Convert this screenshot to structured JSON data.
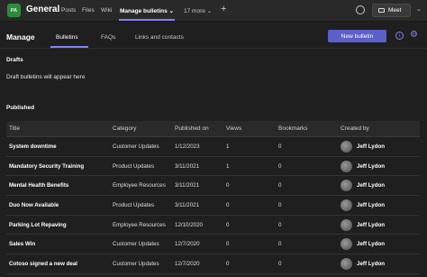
{
  "header": {
    "team_initials": "PA",
    "channel_name": "General",
    "tabs": [
      "Posts",
      "Files",
      "Wiki",
      "Manage bulletins",
      "17 more"
    ],
    "active_tab": "Manage bulletins",
    "meet_label": "Meet"
  },
  "manage": {
    "title": "Manage",
    "tabs": [
      "Bulletins",
      "FAQs",
      "Links and contacts"
    ],
    "active_tab": "Bulletins",
    "new_button": "New bulletin"
  },
  "drafts": {
    "title": "Drafts",
    "empty_text": "Draft bulletins will appear here"
  },
  "published": {
    "title": "Published",
    "columns": [
      "Title",
      "Category",
      "Published on",
      "Views",
      "Bookmarks",
      "Created by"
    ],
    "rows": [
      {
        "title": "System downtime",
        "category": "Customer Updates",
        "published": "1/12/2023",
        "views": "1",
        "bookmarks": "0",
        "author": "Jeff Lydon"
      },
      {
        "title": "Mandatory Security Training",
        "category": "Product Updates",
        "published": "3/11/2021",
        "views": "1",
        "bookmarks": "0",
        "author": "Jeff Lydon"
      },
      {
        "title": "Mental Health Benefits",
        "category": "Employee Resources",
        "published": "3/11/2021",
        "views": "0",
        "bookmarks": "0",
        "author": "Jeff Lydon"
      },
      {
        "title": "Duo Now Available",
        "category": "Product Updates",
        "published": "3/11/2021",
        "views": "0",
        "bookmarks": "0",
        "author": "Jeff Lydon"
      },
      {
        "title": "Parking Lot Repaving",
        "category": "Employee Resources",
        "published": "12/10/2020",
        "views": "0",
        "bookmarks": "0",
        "author": "Jeff Lydon"
      },
      {
        "title": "Sales Win",
        "category": "Customer Updates",
        "published": "12/7/2020",
        "views": "0",
        "bookmarks": "0",
        "author": "Jeff Lydon"
      },
      {
        "title": "Cotoso signed a new deal",
        "category": "Customer Updates",
        "published": "12/7/2020",
        "views": "0",
        "bookmarks": "0",
        "author": "Jeff Lydon"
      }
    ]
  },
  "colors": {
    "accent": "#5b5fc7",
    "background": "#1f1f1f"
  }
}
